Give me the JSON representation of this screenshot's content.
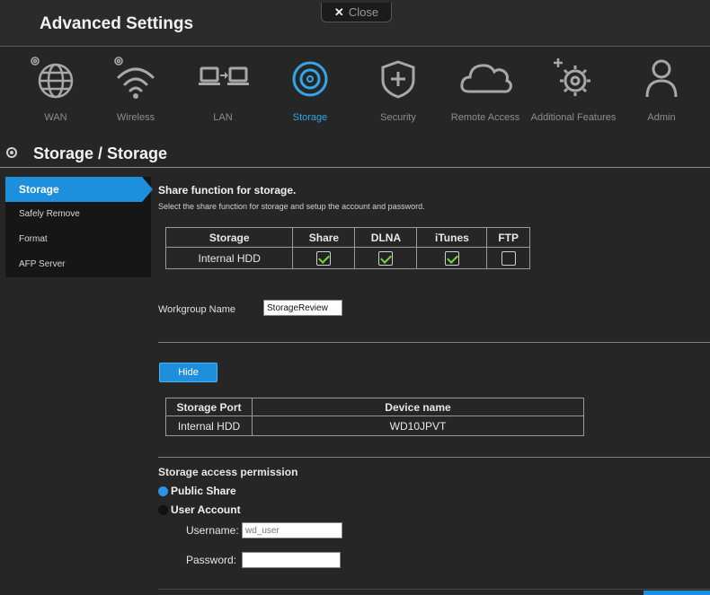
{
  "header": {
    "title": "Advanced Settings",
    "close_label": "Close"
  },
  "nav": {
    "items": [
      {
        "label": "WAN",
        "icon": "globe-gear-icon"
      },
      {
        "label": "Wireless",
        "icon": "wifi-gear-icon"
      },
      {
        "label": "LAN",
        "icon": "lan-computers-icon"
      },
      {
        "label": "Storage",
        "icon": "disc-icon",
        "active": true
      },
      {
        "label": "Security",
        "icon": "shield-plus-icon"
      },
      {
        "label": "Remote Access",
        "icon": "cloud-icon"
      },
      {
        "label": "Additional Features",
        "icon": "gear-plus-icon"
      },
      {
        "label": "Admin",
        "icon": "user-icon"
      }
    ],
    "active_color": "#34a6e8"
  },
  "page": {
    "title": "Storage / Storage"
  },
  "sidebar": {
    "items": [
      {
        "label": "Storage",
        "active": true
      },
      {
        "label": "Safely Remove"
      },
      {
        "label": "Format"
      },
      {
        "label": "AFP Server"
      }
    ]
  },
  "share": {
    "heading": "Share function for storage.",
    "description": "Select the share function for storage and setup the account and password.",
    "columns": [
      "Storage",
      "Share",
      "DLNA",
      "iTunes",
      "FTP"
    ],
    "row": {
      "storage": "Internal HDD",
      "share": true,
      "dlna": true,
      "itunes": true,
      "ftp": false
    }
  },
  "workgroup": {
    "label": "Workgroup Name",
    "value": "StorageReview"
  },
  "hide_button": {
    "label": "Hide"
  },
  "ports": {
    "columns": [
      "Storage Port",
      "Device name"
    ],
    "rows": [
      {
        "port": "Internal HDD",
        "device": "WD10JPVT"
      }
    ]
  },
  "permission": {
    "heading": "Storage access permission",
    "options": [
      {
        "label": "Public Share",
        "selected": true
      },
      {
        "label": "User Account",
        "selected": false
      }
    ],
    "username_label": "Username:",
    "username_placeholder": "wd_user",
    "password_label": "Password:",
    "password_value": ""
  },
  "colors": {
    "accent": "#1e8fdc",
    "check": "#7ad63a",
    "background": "#262626"
  }
}
